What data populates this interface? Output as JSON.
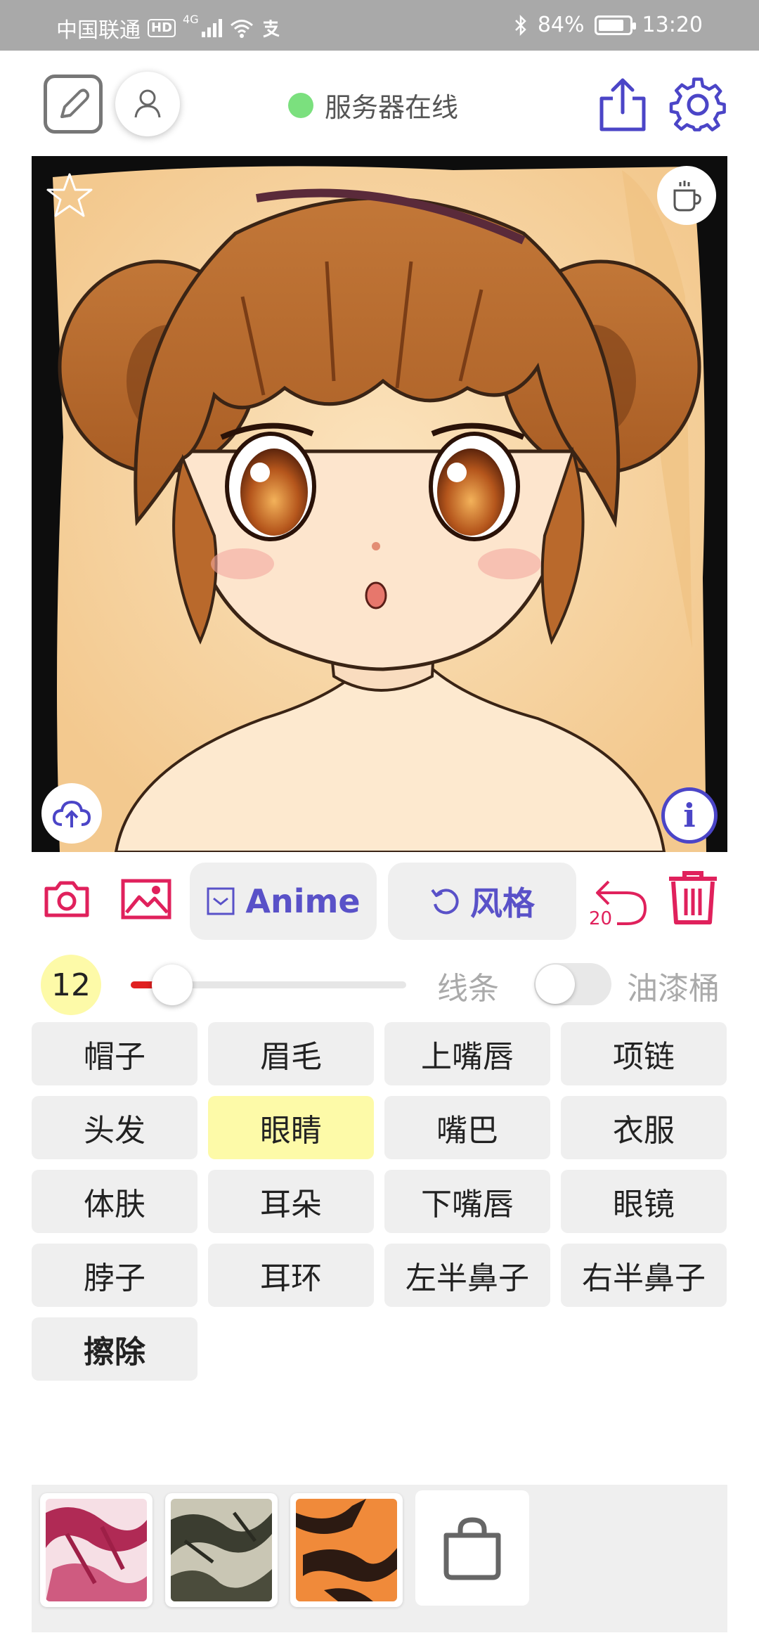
{
  "status_bar": {
    "carrier": "中国联通",
    "hd": "HD",
    "network": "4G",
    "battery_percent": "84%",
    "battery_level": 0.84,
    "time": "13:20"
  },
  "header": {
    "server_status": "服务器在线",
    "status_color": "#7be07e"
  },
  "toolbar": {
    "anime_label": "Anime",
    "style_label": "风格",
    "undo_count": "20"
  },
  "brush": {
    "size": "12",
    "size_fraction": 0.15,
    "line_label": "线条",
    "bucket_label": "油漆桶",
    "bucket_enabled": false
  },
  "parts": [
    {
      "label": "帽子",
      "selected": false
    },
    {
      "label": "眉毛",
      "selected": false
    },
    {
      "label": "上嘴唇",
      "selected": false
    },
    {
      "label": "项链",
      "selected": false
    },
    {
      "label": "头发",
      "selected": false
    },
    {
      "label": "眼睛",
      "selected": true
    },
    {
      "label": "嘴巴",
      "selected": false
    },
    {
      "label": "衣服",
      "selected": false
    },
    {
      "label": "体肤",
      "selected": false
    },
    {
      "label": "耳朵",
      "selected": false
    },
    {
      "label": "下嘴唇",
      "selected": false
    },
    {
      "label": "眼镜",
      "selected": false
    },
    {
      "label": "脖子",
      "selected": false
    },
    {
      "label": "耳环",
      "selected": false
    },
    {
      "label": "左半鼻子",
      "selected": false
    },
    {
      "label": "右半鼻子",
      "selected": false
    },
    {
      "label": "擦除",
      "selected": false
    }
  ],
  "colors": {
    "accent": "#5951c8",
    "danger": "#e0215c",
    "selected": "#fdfaa8",
    "button_bg": "#efefef"
  },
  "icons": {
    "edit": "edit-icon",
    "user": "user-icon",
    "share": "share-icon",
    "settings": "gear-icon",
    "favorite": "star-icon",
    "coffee": "coffee-cup-icon",
    "upload": "cloud-upload-icon",
    "info": "info-icon",
    "camera": "camera-icon",
    "gallery": "image-icon",
    "undo": "undo-icon",
    "delete": "trash-icon",
    "shop": "shopping-bag-icon"
  }
}
